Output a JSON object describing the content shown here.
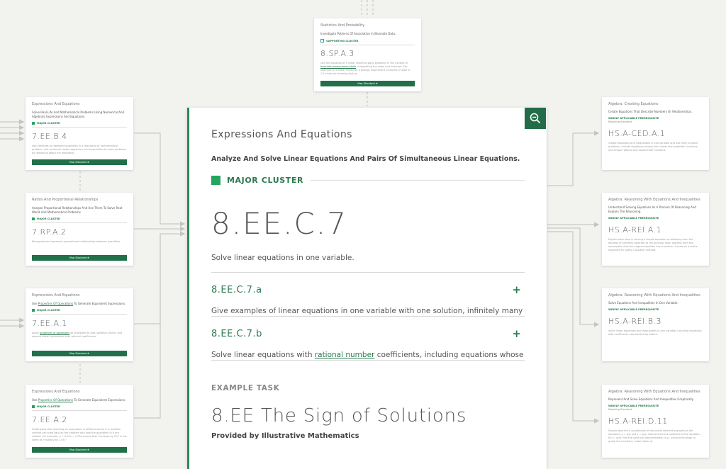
{
  "main": {
    "domain": "Expressions And Equations",
    "cluster": "Analyze And Solve Linear Equations And Pairs Of Simultaneous Linear Equations.",
    "badge": "MAJOR CLUSTER",
    "code": "8.EE.C.7",
    "description": "Solve linear equations in one variable.",
    "substandards": [
      {
        "code": "8.EE.C.7.a",
        "text": "Give examples of linear equations in one variable with one solution, infinitely many"
      },
      {
        "code": "8.EE.C.7.b",
        "text_before": "Solve linear equations with ",
        "link": "rational number",
        "text_after": " coefficients, including equations whose"
      }
    ],
    "example_label": "EXAMPLE TASK",
    "example_title": "8.EE The Sign of Solutions",
    "example_by": "Provided by Illustrative Mathematics",
    "zoom_icon": "zoom-out-icon"
  },
  "top_card": {
    "domain": "Statistics And Probability",
    "cluster": "Investigate Patterns Of Association In Bivariate Data.",
    "badge": "SUPPORTING CLUSTER",
    "code": "8.SP.A.3",
    "desc_before": "Use the equation of a linear model to solve problems in the context of ",
    "desc_link": "bivariate measurement data",
    "desc_after": ", interpreting the slope and intercept. For example, in a linear model for a biology experiment, interpret a slope of 1.5 cm/hr as meaning that an",
    "button": "Map Standard"
  },
  "left_cards": [
    {
      "domain": "Expressions And Equations",
      "cluster": "Solve Real-Life And Mathematical Problems Using Numerical And Algebraic Expressions And Equations.",
      "badge": "MAJOR CLUSTER",
      "code": "7.EE.B.4",
      "desc": "Use variables to represent quantities in a real-world or mathematical problem, and construct simple equations and inequalities to solve problems by reasoning about the quantities.",
      "button": "Map Standard"
    },
    {
      "domain": "Ratios And Proportional Relationships",
      "cluster": "Analyze Proportional Relationships And Use Them To Solve Real-World And Mathematical Problems.",
      "badge": "MAJOR CLUSTER",
      "code": "7.RP.A.2",
      "desc": "Recognize and represent proportional relationships between quantities.",
      "button": "Map Standard"
    },
    {
      "domain": "Expressions And Equations",
      "cluster_before": "Use ",
      "cluster_link": "Properties Of Operations",
      "cluster_after": " To Generate Equivalent Expressions.",
      "badge": "MAJOR CLUSTER",
      "code": "7.EE.A.1",
      "desc_before": "Apply ",
      "desc_link": "properties of operations",
      "desc_after": " as strategies to add, subtract, factor, and expand linear expressions with rational coefficients.",
      "button": "Map Standard"
    },
    {
      "domain": "Expressions And Equations",
      "cluster_before": "Use ",
      "cluster_link": "Properties Of Operations",
      "cluster_after": " To Generate Equivalent Expressions.",
      "badge": "MAJOR CLUSTER",
      "code": "7.EE.A.2",
      "desc": "Understand that rewriting an expression in different forms in a problem context can shed light on the problem and how the quantities in it are related. For example, a + 0.05a = 1.05a means that \"increase by 5%\" is the same as \"multiply by 1.05.\"",
      "button": "Map Standard"
    }
  ],
  "right_cards": [
    {
      "domain": "Algebra: Creating Equations",
      "cluster": "Create Equations That Describe Numbers Or Relationships.",
      "badge": "WIDELY APPLICABLE PREREQUISITE",
      "sub": "Modeling Standard",
      "code": "HS.A-CED.A.1",
      "desc": "Create equations and inequalities in one variable and use them to solve problems. Include equations arising from linear and quadratic functions, and simple rational and exponential functions."
    },
    {
      "domain": "Algebra: Reasoning With Equations And Inequalities",
      "cluster": "Understand Solving Equations As A Process Of Reasoning And Explain The Reasoning.",
      "badge": "WIDELY APPLICABLE PREREQUISITE",
      "sub": "",
      "code": "HS.A-REI.A.1",
      "desc": "Explain each step in solving a simple equation as following from the equality of numbers asserted at the previous step, starting from the assumption that the original equation has a solution. Construct a viable argument to justify a solution method."
    },
    {
      "domain": "Algebra: Reasoning With Equations And Inequalities",
      "cluster": "Solve Equations And Inequalities In One Variable.",
      "badge": "WIDELY APPLICABLE PREREQUISITE",
      "sub": "",
      "code": "HS.A-REI.B.3",
      "desc": "Solve linear equations and inequalities in one variable, including equations with coefficients represented by letters."
    },
    {
      "domain": "Algebra: Reasoning With Equations And Inequalities",
      "cluster": "Represent And Solve Equations And Inequalities Graphically.",
      "badge": "WIDELY APPLICABLE PREREQUISITE",
      "sub": "Modeling Standard",
      "code": "HS.A-REI.D.11",
      "desc": "Explain why the x-coordinates of the points where the graphs of the equations y = f(x) and y = g(x) intersect are the solutions of the equation f(x) = g(x); find the solutions approximately, e.g., using technology to graph the functions, make tables of"
    }
  ],
  "colors": {
    "accent": "#2a7a4f",
    "button": "#21704a",
    "major": "#25a55f",
    "supporting": "#2aa6b5",
    "background": "#f2f2ef"
  }
}
